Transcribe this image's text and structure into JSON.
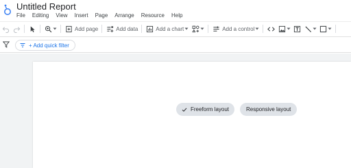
{
  "header": {
    "title": "Untitled Report",
    "menu": [
      "File",
      "Editing",
      "View",
      "Insert",
      "Page",
      "Arrange",
      "Resource",
      "Help"
    ]
  },
  "toolbar": {
    "add_page": "Add page",
    "add_data": "Add data",
    "add_chart": "Add a chart",
    "add_control": "Add a control"
  },
  "filterbar": {
    "quick_filter": "+ Add quick filter"
  },
  "layout_options": {
    "freeform": "Freeform layout",
    "responsive": "Responsive layout"
  },
  "colors": {
    "accent": "#1a73e8",
    "chip_bg": "#dfe3e8",
    "canvas_bg": "#f1f3f4"
  }
}
